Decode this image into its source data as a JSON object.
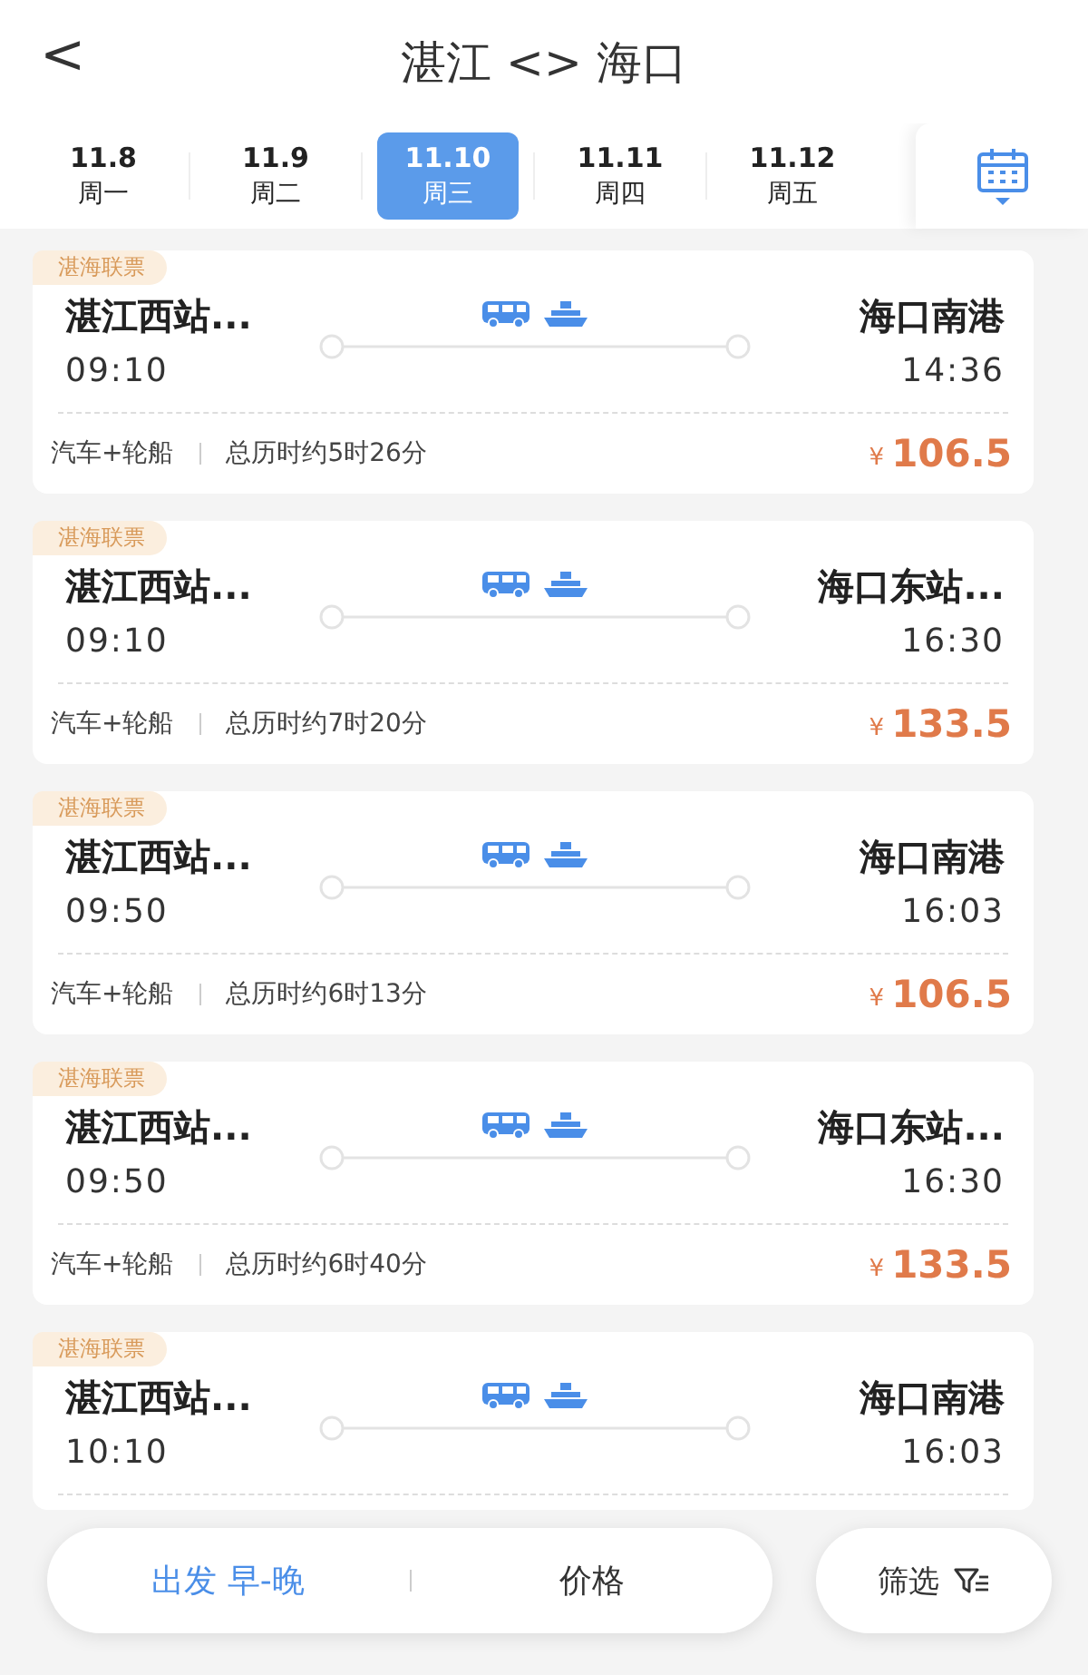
{
  "header": {
    "back": "<",
    "title": "湛江 <> 海口"
  },
  "dates": [
    {
      "date": "11.8",
      "weekday": "周一",
      "selected": false
    },
    {
      "date": "11.9",
      "weekday": "周二",
      "selected": false
    },
    {
      "date": "11.10",
      "weekday": "周三",
      "selected": true
    },
    {
      "date": "11.11",
      "weekday": "周四",
      "selected": false
    },
    {
      "date": "11.12",
      "weekday": "周五",
      "selected": false
    }
  ],
  "trips": [
    {
      "tag": "湛海联票",
      "from": "湛江西站...",
      "to": "海口南港",
      "depart": "09:10",
      "arrive": "14:36",
      "mode": "汽车+轮船",
      "duration": "总历时约5时26分",
      "currency": "¥",
      "price": "106.5"
    },
    {
      "tag": "湛海联票",
      "from": "湛江西站...",
      "to": "海口东站...",
      "depart": "09:10",
      "arrive": "16:30",
      "mode": "汽车+轮船",
      "duration": "总历时约7时20分",
      "currency": "¥",
      "price": "133.5"
    },
    {
      "tag": "湛海联票",
      "from": "湛江西站...",
      "to": "海口南港",
      "depart": "09:50",
      "arrive": "16:03",
      "mode": "汽车+轮船",
      "duration": "总历时约6时13分",
      "currency": "¥",
      "price": "106.5"
    },
    {
      "tag": "湛海联票",
      "from": "湛江西站...",
      "to": "海口东站...",
      "depart": "09:50",
      "arrive": "16:30",
      "mode": "汽车+轮船",
      "duration": "总历时约6时40分",
      "currency": "¥",
      "price": "133.5"
    },
    {
      "tag": "湛海联票",
      "from": "湛江西站...",
      "to": "海口南港",
      "depart": "10:10",
      "arrive": "16:03"
    }
  ],
  "bottom_bar": {
    "sort_departure": "出发 早-晚",
    "sort_price": "价格",
    "filter": "筛选"
  }
}
